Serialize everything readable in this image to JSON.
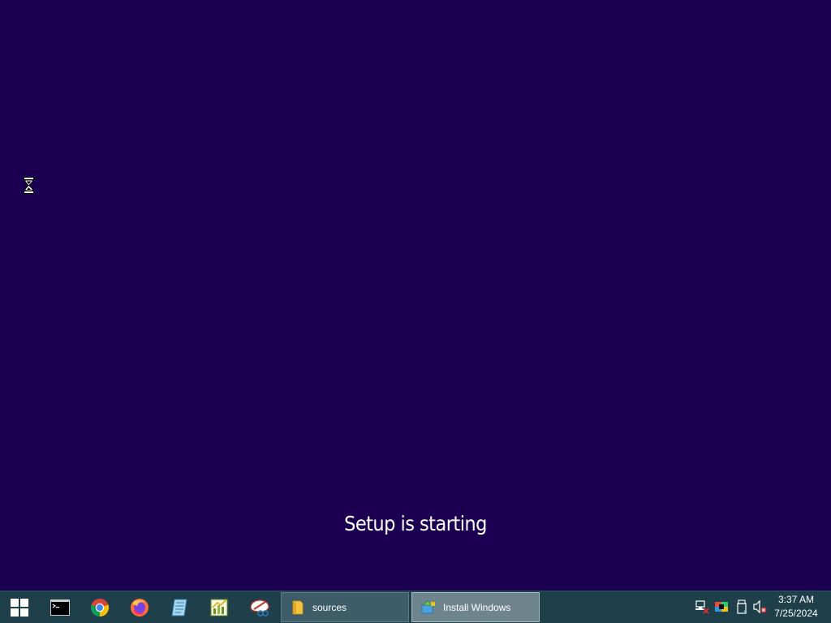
{
  "setup": {
    "status_text": "Setup is starting"
  },
  "taskbar": {
    "start_icon": "windows-logo-icon",
    "pinned": [
      {
        "icon": "command-prompt-icon"
      },
      {
        "icon": "chrome-icon"
      },
      {
        "icon": "firefox-icon"
      },
      {
        "icon": "notepad-icon"
      },
      {
        "icon": "chart-app-icon"
      },
      {
        "icon": "snipping-tool-icon"
      }
    ],
    "tasks": [
      {
        "label": "sources",
        "icon": "folder-icon",
        "active": false
      },
      {
        "label": "Install Windows",
        "icon": "install-windows-icon",
        "active": true
      }
    ],
    "tray": {
      "icons": [
        "network-icon",
        "color-palette-icon",
        "usb-drive-icon",
        "volume-muted-icon"
      ]
    },
    "clock": {
      "time": "3:37 AM",
      "date": "7/25/2024"
    }
  },
  "colors": {
    "desktop_background": "#1b0052",
    "taskbar_background": "#1f3f4a",
    "active_task": "#6f858e"
  }
}
